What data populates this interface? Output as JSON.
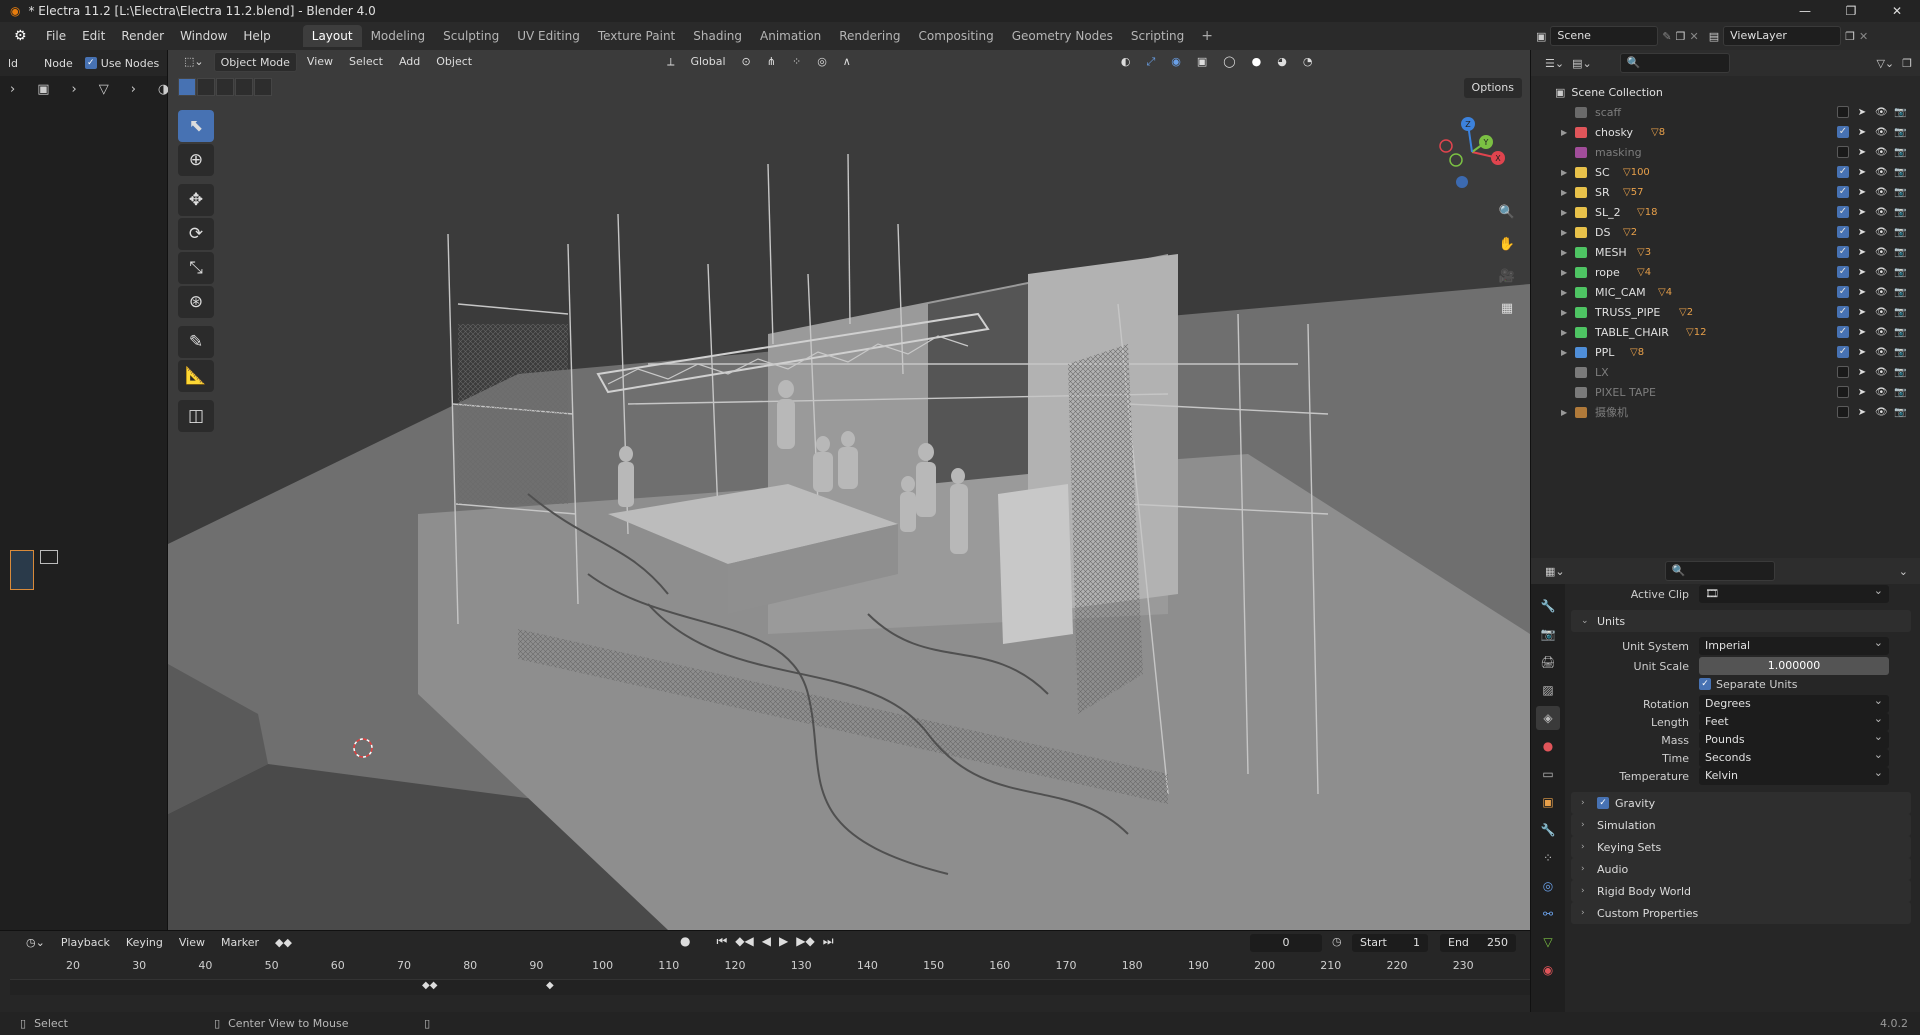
{
  "window": {
    "title": "* Electra 11.2 [L:\\Electra\\Electra 11.2.blend] - Blender 4.0",
    "minimize": "—",
    "maximize": "❐",
    "close": "✕"
  },
  "menubar": {
    "items": [
      "File",
      "Edit",
      "Render",
      "Window",
      "Help"
    ],
    "workspaces": [
      "Layout",
      "Modeling",
      "Sculpting",
      "UV Editing",
      "Texture Paint",
      "Shading",
      "Animation",
      "Rendering",
      "Compositing",
      "Geometry Nodes",
      "Scripting"
    ],
    "add_workspace": "+"
  },
  "scenebar": {
    "scene": "Scene",
    "view_layer": "ViewLayer"
  },
  "node_editor": {
    "add_cut": "ld",
    "node_menu": "Node",
    "use_nodes": "Use Nodes"
  },
  "viewport": {
    "mode": "Object Mode",
    "menus": [
      "View",
      "Select",
      "Add",
      "Object"
    ],
    "transform_orientation": "Global",
    "options": "Options",
    "gizmo": {
      "x": "X",
      "y": "Y",
      "z": "Z"
    }
  },
  "timeline": {
    "menus": [
      "Playback",
      "Keying",
      "View",
      "Marker"
    ],
    "current_frame": "0",
    "start_label": "Start",
    "start": "1",
    "end_label": "End",
    "end": "250",
    "ruler": [
      "20",
      "30",
      "40",
      "50",
      "60",
      "70",
      "80",
      "90",
      "100",
      "110",
      "120",
      "130",
      "140",
      "150",
      "160",
      "170",
      "180",
      "190",
      "200",
      "210",
      "220",
      "230"
    ]
  },
  "statusbar": {
    "select": "Select",
    "center_view": "Center View to Mouse",
    "version": "4.0.2"
  },
  "outliner": {
    "root": "Scene Collection",
    "collections": [
      {
        "name": "scaff",
        "color": "#6a6a6a",
        "dim": true,
        "expand": false,
        "count": "",
        "checked": false
      },
      {
        "name": "chosky",
        "color": "#e0555a",
        "dim": false,
        "expand": true,
        "count": "8",
        "checked": true
      },
      {
        "name": "masking",
        "color": "#a14d9a",
        "dim": true,
        "expand": false,
        "count": "",
        "checked": false
      },
      {
        "name": "SC",
        "color": "#e8c14a",
        "dim": false,
        "expand": true,
        "count": "100",
        "checked": true
      },
      {
        "name": "SR",
        "color": "#e8c14a",
        "dim": false,
        "expand": true,
        "count": "57",
        "checked": true
      },
      {
        "name": "SL_2",
        "color": "#e8c14a",
        "dim": false,
        "expand": true,
        "count": "18",
        "checked": true
      },
      {
        "name": "DS",
        "color": "#e8c14a",
        "dim": false,
        "expand": true,
        "count": "2",
        "checked": true
      },
      {
        "name": "MESH",
        "color": "#4ec463",
        "dim": false,
        "expand": true,
        "count": "3",
        "checked": true
      },
      {
        "name": "rope",
        "color": "#4ec463",
        "dim": false,
        "expand": true,
        "count": "4",
        "checked": true
      },
      {
        "name": "MIC_CAM",
        "color": "#4ec463",
        "dim": false,
        "expand": true,
        "count": "4",
        "checked": true
      },
      {
        "name": "TRUSS_PIPE",
        "color": "#4ec463",
        "dim": false,
        "expand": true,
        "count": "2",
        "checked": true
      },
      {
        "name": "TABLE_CHAIR",
        "color": "#4ec463",
        "dim": false,
        "expand": true,
        "count": "12",
        "checked": true
      },
      {
        "name": "PPL",
        "color": "#4f8ed8",
        "dim": false,
        "expand": true,
        "count": "8",
        "checked": true
      },
      {
        "name": "LX",
        "color": "#7a7a7a",
        "dim": true,
        "expand": false,
        "count": "",
        "checked": false
      },
      {
        "name": "PIXEL TAPE",
        "color": "#7a7a7a",
        "dim": true,
        "expand": false,
        "count": "",
        "checked": false
      },
      {
        "name": "摄像机",
        "color": "#b07a3a",
        "dim": true,
        "expand": true,
        "count": "",
        "checked": false
      }
    ]
  },
  "properties": {
    "active_clip_label": "Active Clip",
    "units_panel": "Units",
    "unit_system_label": "Unit System",
    "unit_system": "Imperial",
    "unit_scale_label": "Unit Scale",
    "unit_scale": "1.000000",
    "separate_units": "Separate Units",
    "rotation_label": "Rotation",
    "rotation": "Degrees",
    "length_label": "Length",
    "length": "Feet",
    "mass_label": "Mass",
    "mass": "Pounds",
    "time_label": "Time",
    "time": "Seconds",
    "temperature_label": "Temperature",
    "temperature": "Kelvin",
    "panels": [
      "Gravity",
      "Simulation",
      "Keying Sets",
      "Audio",
      "Rigid Body World",
      "Custom Properties"
    ]
  }
}
